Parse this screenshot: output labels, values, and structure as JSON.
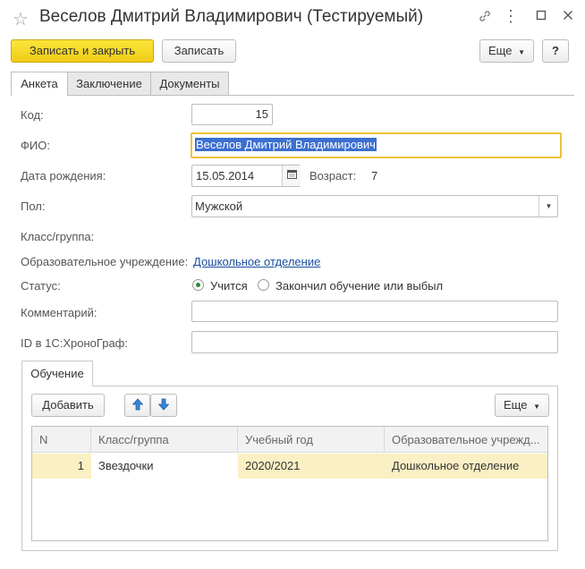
{
  "window": {
    "title": "Веселов Дмитрий Владимирович (Тестируемый)"
  },
  "toolbar": {
    "save_close": "Записать и закрыть",
    "save": "Записать",
    "more": "Еще",
    "help": "?"
  },
  "tabs": [
    {
      "label": "Анкета",
      "active": true
    },
    {
      "label": "Заключение",
      "active": false
    },
    {
      "label": "Документы",
      "active": false
    }
  ],
  "form": {
    "code_label": "Код:",
    "code_value": "15",
    "fio_label": "ФИО:",
    "fio_value": "Веселов Дмитрий Владимирович",
    "birth_label": "Дата рождения:",
    "birth_value": "15.05.2014",
    "age_label": "Возраст:",
    "age_value": "7",
    "gender_label": "Пол:",
    "gender_value": "Мужской",
    "class_label": "Класс/группа:",
    "edu_label": "Образовательное учреждение:",
    "edu_value": "Дошкольное отделение",
    "status_label": "Статус:",
    "status_options": [
      "Учится",
      "Закончил обучение или выбыл"
    ],
    "status_selected": 0,
    "comment_label": "Комментарий:",
    "comment_value": "",
    "id_label": "ID в 1С:ХроноГраф:",
    "id_value": ""
  },
  "study": {
    "tab_label": "Обучение",
    "add": "Добавить",
    "more": "Еще",
    "columns": [
      "N",
      "Класс/группа",
      "Учебный год",
      "Образовательное учрежд..."
    ],
    "rows": [
      {
        "n": "1",
        "class": "Звездочки",
        "year": "2020/2021",
        "org": "Дошкольное отделение"
      }
    ]
  },
  "colors": {
    "primary_button": "#f4d428",
    "selected_row": "#fbf0c4",
    "focus_border": "#f0c23c",
    "link": "#1a4f9c"
  }
}
